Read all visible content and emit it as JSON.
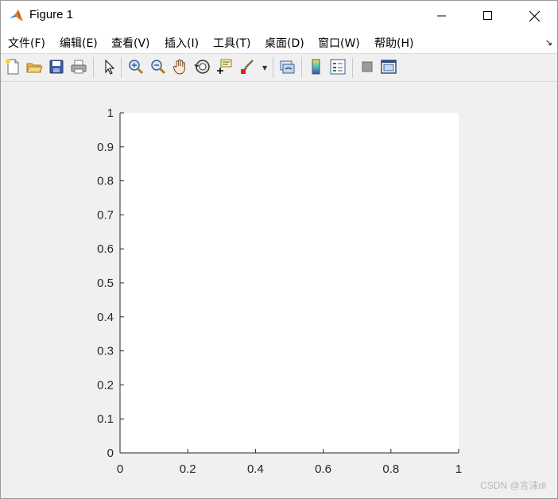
{
  "window": {
    "title": "Figure 1"
  },
  "menu": [
    {
      "label": "文件(F)",
      "key": "file"
    },
    {
      "label": "编辑(E)",
      "key": "edit"
    },
    {
      "label": "查看(V)",
      "key": "view"
    },
    {
      "label": "插入(I)",
      "key": "insert"
    },
    {
      "label": "工具(T)",
      "key": "tools"
    },
    {
      "label": "桌面(D)",
      "key": "desktop"
    },
    {
      "label": "窗口(W)",
      "key": "window"
    },
    {
      "label": "帮助(H)",
      "key": "help"
    }
  ],
  "toolbar": {
    "buttons": [
      "new-figure-icon",
      "open-file-icon",
      "save-icon",
      "print-icon",
      "edit-plot-arrow-icon",
      "zoom-in-icon",
      "zoom-out-icon",
      "pan-hand-icon",
      "rotate-3d-icon",
      "data-cursor-icon",
      "brush-icon",
      "link-plot-icon",
      "colorbar-icon",
      "legend-icon",
      "hide-plot-tools-icon",
      "show-plot-tools-icon"
    ]
  },
  "chart_data": {
    "type": "line",
    "series": [],
    "xlim": [
      0,
      1
    ],
    "ylim": [
      0,
      1
    ],
    "xticks": [
      "0",
      "0.2",
      "0.4",
      "0.6",
      "0.8",
      "1"
    ],
    "yticks": [
      "0",
      "0.1",
      "0.2",
      "0.3",
      "0.4",
      "0.5",
      "0.6",
      "0.7",
      "0.8",
      "0.9",
      "1"
    ],
    "grid": false,
    "title": "",
    "xlabel": "",
    "ylabel": ""
  },
  "watermark": "CSDN @言沫dl",
  "colors": {
    "axes_bg": "#ffffff",
    "figure_bg": "#f0f0f0",
    "axis_color": "#262626"
  }
}
